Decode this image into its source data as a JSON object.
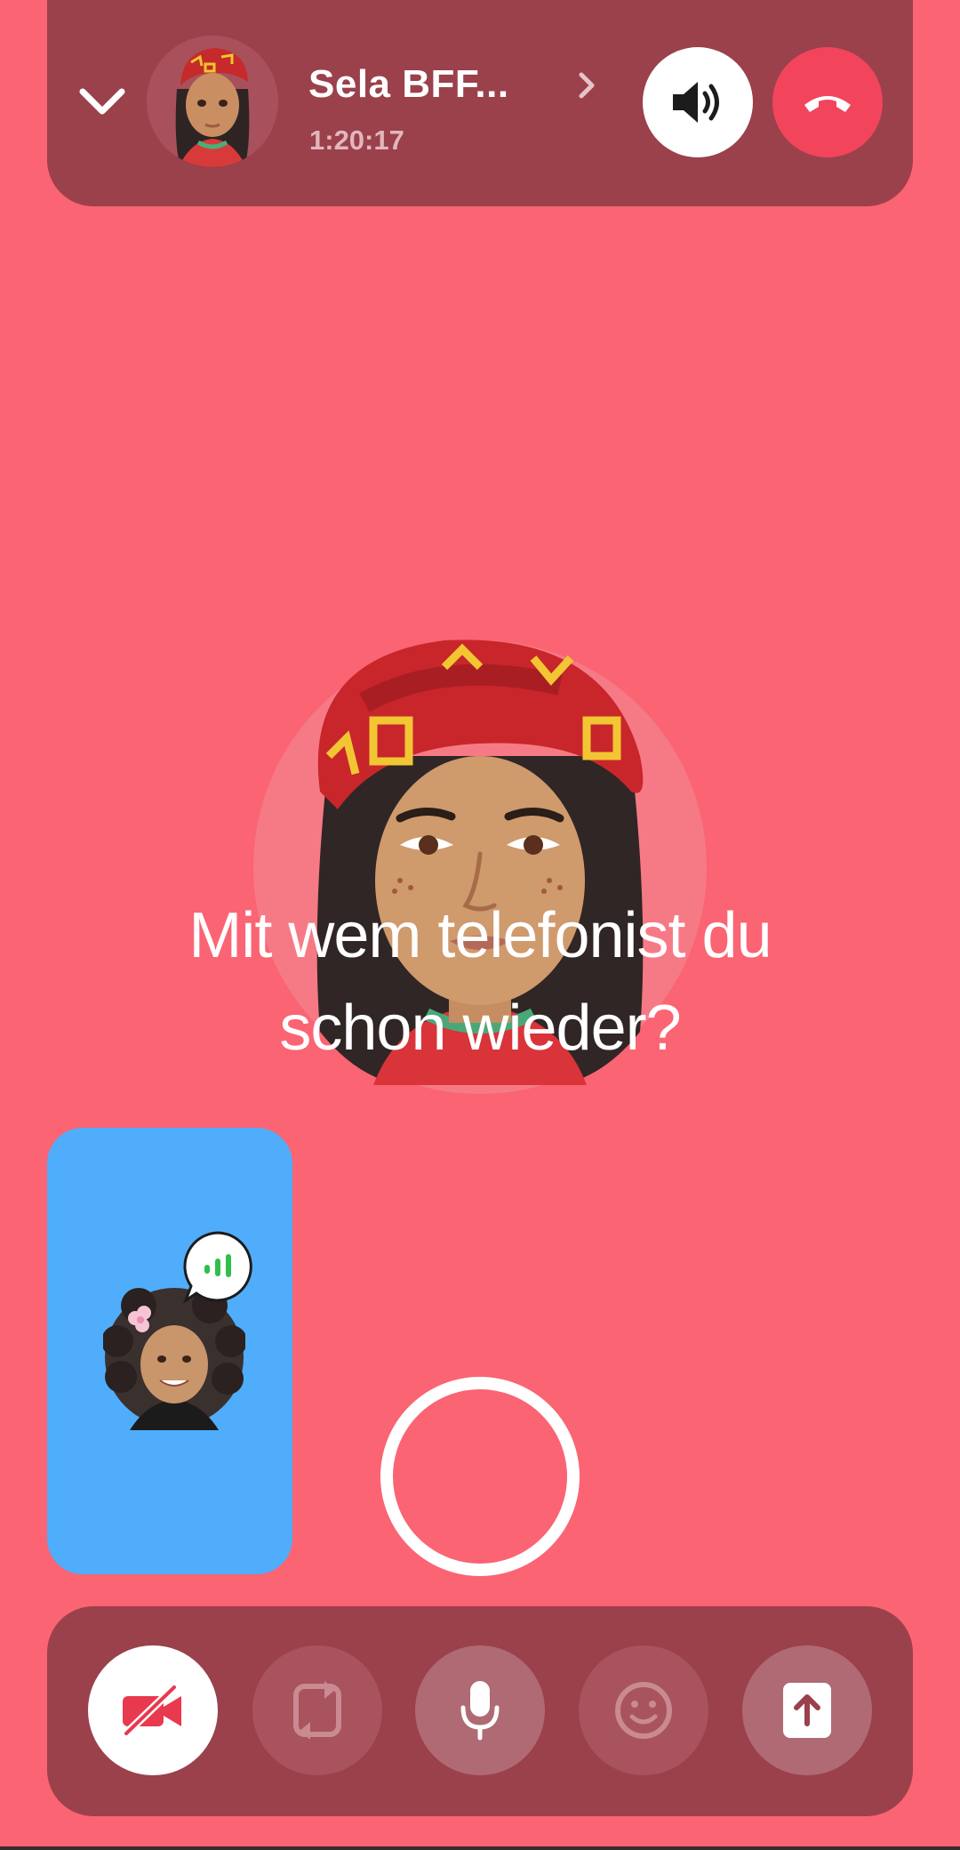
{
  "call": {
    "contact_name": "Sela BFF...",
    "duration": "1:20:17"
  },
  "caption": {
    "line1": "Mit wem telefonist du",
    "line2": "schon wieder?"
  },
  "icons": {
    "collapse": "chevron-down-icon",
    "open_profile": "chevron-right-icon",
    "speaker": "speaker-icon",
    "hang_up": "phone-hangup-icon",
    "camera_off": "video-off-icon",
    "flip_camera": "camera-flip-icon",
    "microphone": "microphone-icon",
    "lenses": "smiley-icon",
    "share": "share-upload-icon",
    "speaking": "audio-level-icon"
  },
  "colors": {
    "background": "#fb6473",
    "bar": "#9a414c",
    "hangup": "#f2455c",
    "self_view": "#4fadfb",
    "speaking_indicator": "#2fbf4a"
  }
}
